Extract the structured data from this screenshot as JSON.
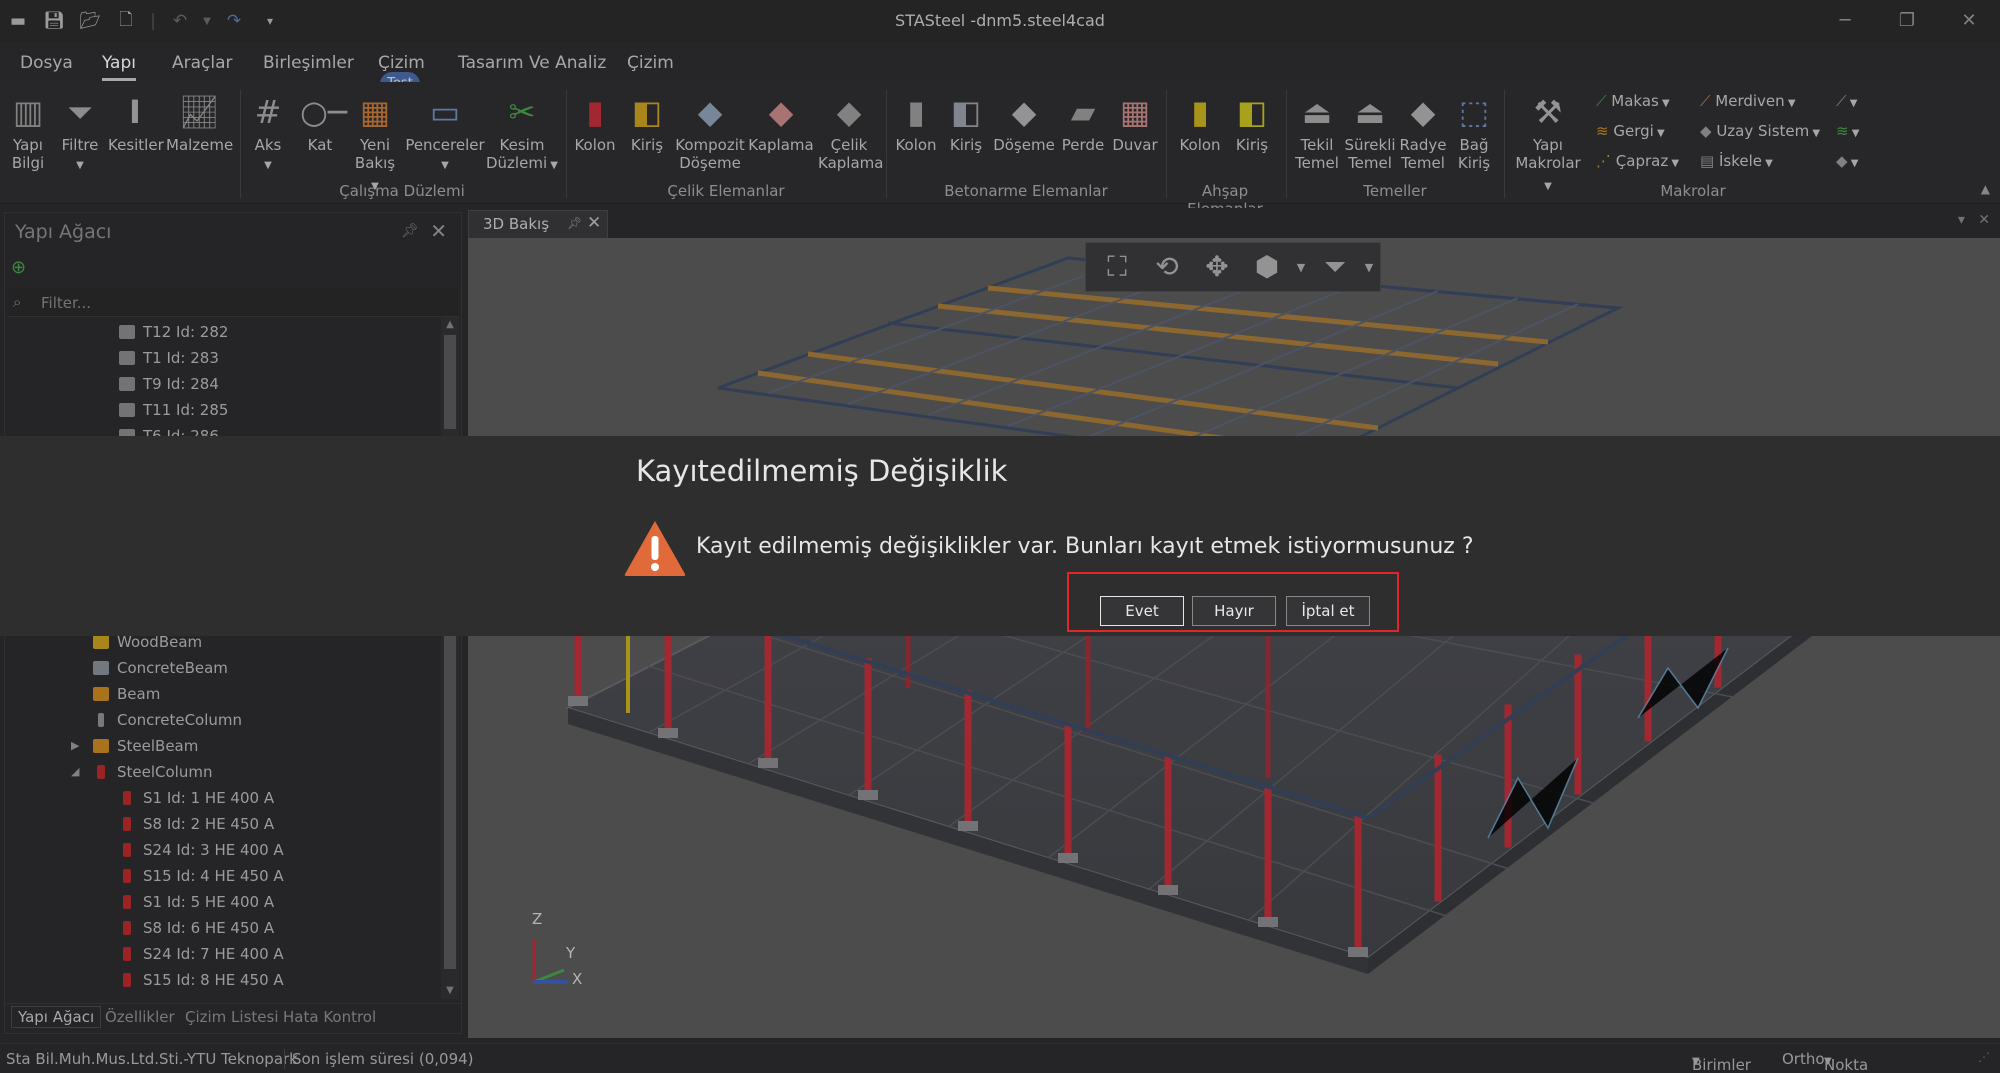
{
  "window": {
    "title": "STASteel -dnm5.steel4cad",
    "qat_icons": [
      "app-menu-icon",
      "save-icon",
      "open-folder-icon",
      "new-file-icon",
      "undo-icon",
      "undo-dropdown-icon",
      "redo-icon",
      "customize-qat-icon"
    ],
    "controls": [
      "minimize-icon",
      "restore-icon",
      "close-icon"
    ]
  },
  "menu": {
    "tabs": [
      "Dosya",
      "Yapı",
      "Araçlar",
      "Birleşimler",
      "Çizim",
      "Tasarım Ve Analiz",
      "Çizim"
    ],
    "active_index": 1,
    "badge": "Test"
  },
  "ribbon": {
    "groups": {
      "calisma": "Çalışma Düzlemi",
      "celik": "Çelik Elemanlar",
      "betonarme": "Betonarme Elemanlar",
      "ahsap": "Ahşap Elemanlar",
      "temeller": "Temeller",
      "makrolar": "Makrolar"
    },
    "buttons": {
      "yapi_bilgi": [
        "Yapı",
        "Bilgi"
      ],
      "filtre": "Filtre",
      "kesitler": "Kesitler",
      "malzeme": "Malzeme",
      "aks": "Aks",
      "kat": "Kat",
      "yeni_bakis": [
        "Yeni",
        "Bakış"
      ],
      "pencereler": "Pencereler",
      "kesim_duzlemi": [
        "Kesim",
        "Düzlemi"
      ],
      "celik_kolon": "Kolon",
      "celik_kiris": "Kiriş",
      "kompozit": [
        "Kompozit",
        "Döşeme"
      ],
      "kaplama": "Kaplama",
      "celik_kaplama": [
        "Çelik",
        "Kaplama"
      ],
      "bet_kolon": "Kolon",
      "bet_kiris": "Kiriş",
      "doseme": "Döşeme",
      "perde": "Perde",
      "duvar": "Duvar",
      "ahs_kolon": "Kolon",
      "ahs_kiris": "Kiriş",
      "tekil": [
        "Tekil",
        "Temel"
      ],
      "surekli": [
        "Sürekli",
        "Temel"
      ],
      "radye": [
        "Radye",
        "Temel"
      ],
      "bag": [
        "Bağ",
        "Kiriş"
      ],
      "yapi_makrolar": [
        "Yapı",
        "Makrolar"
      ]
    },
    "small": {
      "makas": "Makas",
      "gergi": "Gergi",
      "capraz": "Çapraz",
      "merdiven": "Merdiven",
      "uzay": "Uzay Sistem",
      "iskele": "İskele"
    }
  },
  "left_panel": {
    "title": "Yapı Ağacı",
    "filter_placeholder": "Filter...",
    "top_rows": [
      "T12 Id: 282",
      "T1 Id: 283",
      "T9 Id: 284",
      "T11 Id: 285",
      "T6 Id: 286"
    ],
    "bottom_rows": [
      {
        "label": "WoodBeam",
        "color": "#c9a021"
      },
      {
        "label": "ConcreteBeam",
        "color": "#8a8f99"
      },
      {
        "label": "Beam",
        "color": "#c98a21"
      },
      {
        "label": "ConcreteColumn",
        "color": "#8f8f8f"
      },
      {
        "label": "SteelBeam",
        "color": "#c98a21"
      },
      {
        "label": "SteelColumn",
        "color": "#b82b2b"
      },
      {
        "label": "S1 Id: 1 HE 400 A",
        "color": "#b82b2b"
      },
      {
        "label": "S8 Id: 2 HE 450 A",
        "color": "#b82b2b"
      },
      {
        "label": "S24 Id: 3 HE 400 A",
        "color": "#b82b2b"
      },
      {
        "label": "S15 Id: 4 HE 450 A",
        "color": "#b82b2b"
      },
      {
        "label": "S1 Id: 5 HE 400 A",
        "color": "#b82b2b"
      },
      {
        "label": "S8 Id: 6 HE 450 A",
        "color": "#b82b2b"
      },
      {
        "label": "S24 Id: 7 HE 400 A",
        "color": "#b82b2b"
      },
      {
        "label": "S15 Id: 8 HE 450 A",
        "color": "#b82b2b"
      }
    ],
    "bottom_tabs": [
      "Yapı Ağacı",
      "Özellikler",
      "Çizim Listesi",
      "Hata Kontrol"
    ]
  },
  "document": {
    "tab_label": "3D Bakış",
    "view_tools": [
      "zoom-extents-icon",
      "rotate-icon",
      "pan-icon",
      "view-cube-icon",
      "filter-icon"
    ],
    "axes": {
      "z": "Z",
      "y": "Y",
      "x": "X"
    }
  },
  "status": {
    "company": "Sta Bil.Muh.Mus.Ltd.Sti.-YTU Teknopark",
    "last_op": "Son işlem süresi (0,094)",
    "units": "Birimler",
    "ortho": "Ortho",
    "snap": "Nokta Yakalama"
  },
  "dialog": {
    "title": "Kayıtedilmemiş Değişiklik",
    "message": "Kayıt edilmemiş değişiklikler var. Bunları kayıt etmek istiyormusunuz ?",
    "yes": "Evet",
    "no": "Hayır",
    "cancel": "İptal et",
    "warning_color": "#e06a3a",
    "highlight_color": "#e0262a"
  },
  "colors": {
    "steel_column": "#c0303a",
    "steel_beam": "#b8862e",
    "viewport_bg": "#5b5b5b"
  }
}
